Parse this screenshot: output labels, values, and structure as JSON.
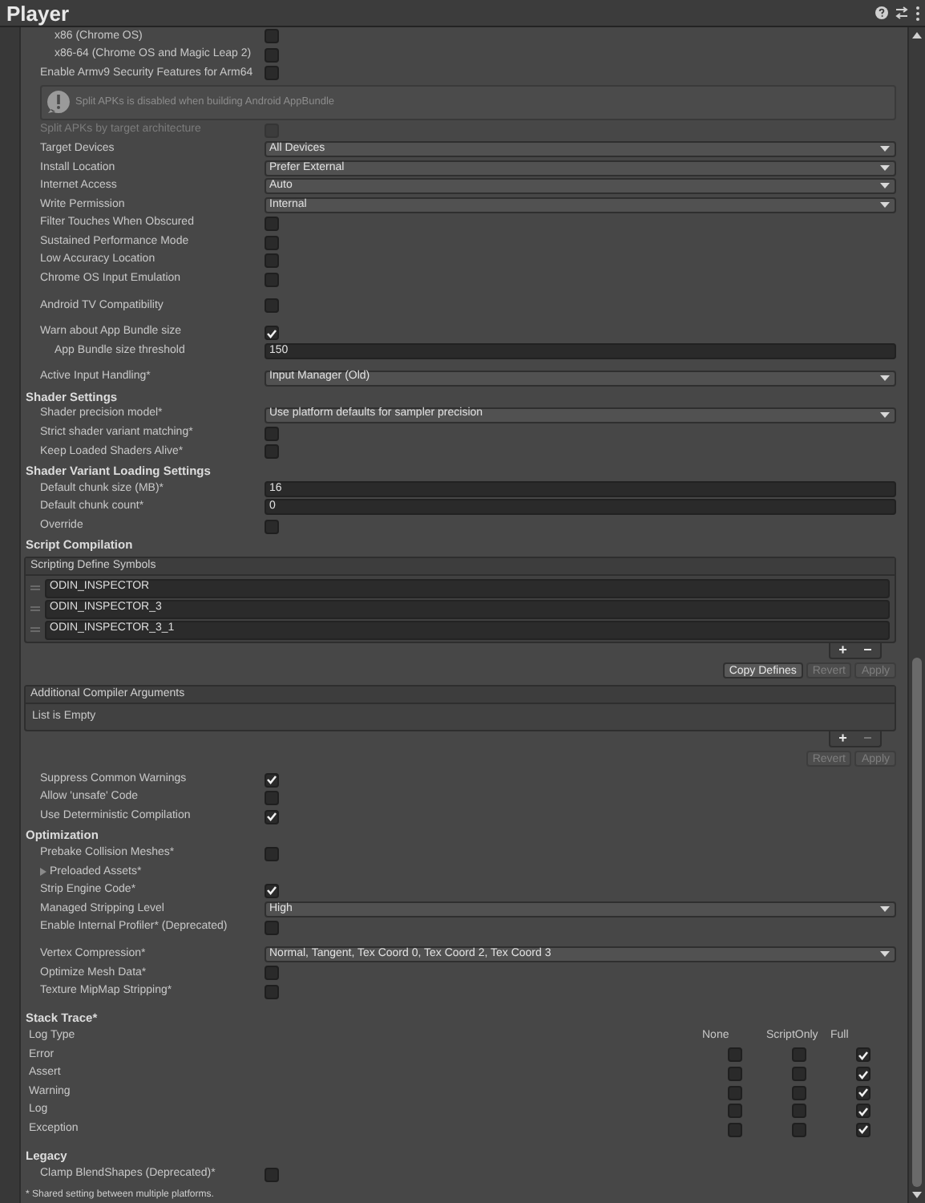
{
  "window": {
    "title": "Player"
  },
  "sections": [
    [
      {
        "kind": "toggle",
        "label": "x86 (Chrome OS)",
        "indented": true,
        "checked": false
      },
      {
        "kind": "toggle",
        "label": "x86-64 (Chrome OS and Magic Leap 2)",
        "indented": true,
        "checked": false
      },
      {
        "kind": "toggle",
        "label": "Enable Armv9 Security Features for Arm64",
        "checked": false
      },
      {
        "kind": "help",
        "text": "Split APKs is disabled when building Android AppBundle"
      },
      {
        "kind": "toggle",
        "label": "Split APKs by target architecture",
        "checked": false,
        "disabled": true
      },
      {
        "kind": "dropdown",
        "label": "Target Devices",
        "value": "All Devices"
      },
      {
        "kind": "dropdown",
        "label": "Install Location",
        "value": "Prefer External"
      },
      {
        "kind": "dropdown",
        "label": "Internet Access",
        "value": "Auto"
      },
      {
        "kind": "dropdown",
        "label": "Write Permission",
        "value": "Internal"
      },
      {
        "kind": "toggle",
        "label": "Filter Touches When Obscured",
        "checked": false
      },
      {
        "kind": "toggle",
        "label": "Sustained Performance Mode",
        "checked": false
      },
      {
        "kind": "toggle",
        "label": "Low Accuracy Location",
        "checked": false
      },
      {
        "kind": "toggle",
        "label": "Chrome OS Input Emulation",
        "checked": false
      }
    ],
    [
      {
        "kind": "toggle",
        "label": "Android TV Compatibility",
        "checked": false
      }
    ],
    [
      {
        "kind": "toggle",
        "label": "Warn about App Bundle size",
        "checked": true
      },
      {
        "kind": "number",
        "label": "App Bundle size threshold",
        "value": "150",
        "indented": true
      }
    ],
    [
      {
        "kind": "dropdown",
        "label": "Active Input Handling*",
        "value": "Input Manager (Old)"
      },
      {
        "kind": "header",
        "text": "Shader Settings"
      },
      {
        "kind": "dropdown",
        "label": "Shader precision model*",
        "value": "Use platform defaults for sampler precision"
      },
      {
        "kind": "toggle",
        "label": "Strict shader variant matching*",
        "checked": false
      },
      {
        "kind": "toggle",
        "label": "Keep Loaded Shaders Alive*",
        "checked": false
      },
      {
        "kind": "header",
        "text": "Shader Variant Loading Settings"
      },
      {
        "kind": "number",
        "label": "Default chunk size (MB)*",
        "value": "16"
      },
      {
        "kind": "number",
        "label": "Default chunk count*",
        "value": "0"
      },
      {
        "kind": "toggle",
        "label": "Override",
        "checked": false
      },
      {
        "kind": "header",
        "text": "Script Compilation"
      },
      {
        "kind": "list",
        "title": "Scripting Define Symbols",
        "items": [
          "ODIN_INSPECTOR",
          "ODIN_INSPECTOR_3",
          "ODIN_INSPECTOR_3_1"
        ],
        "add": "+",
        "remove": "−",
        "remove_disabled": false
      },
      {
        "kind": "actions",
        "buttons": [
          {
            "label": "Copy Defines",
            "disabled": false
          },
          {
            "label": "Revert",
            "disabled": true
          },
          {
            "label": "Apply",
            "disabled": true
          }
        ]
      },
      {
        "kind": "list",
        "title": "Additional Compiler Arguments",
        "empty_text": "List is Empty",
        "add": "+",
        "remove": "−",
        "remove_disabled": true
      },
      {
        "kind": "actions",
        "buttons": [
          {
            "label": "Revert",
            "disabled": true
          },
          {
            "label": "Apply",
            "disabled": true
          }
        ]
      },
      {
        "kind": "toggle",
        "label": "Suppress Common Warnings",
        "checked": true
      },
      {
        "kind": "toggle",
        "label": "Allow 'unsafe' Code",
        "checked": false
      },
      {
        "kind": "toggle",
        "label": "Use Deterministic Compilation",
        "checked": true
      },
      {
        "kind": "header",
        "text": "Optimization"
      },
      {
        "kind": "toggle",
        "label": "Prebake Collision Meshes*",
        "checked": false
      },
      {
        "kind": "foldout",
        "label": "Preloaded Assets*",
        "expanded": false
      },
      {
        "kind": "toggle",
        "label": "Strip Engine Code*",
        "checked": true
      },
      {
        "kind": "dropdown",
        "label": "Managed Stripping Level",
        "value": "High"
      },
      {
        "kind": "toggle",
        "label": "Enable Internal Profiler* (Deprecated)",
        "checked": false
      }
    ],
    [
      {
        "kind": "dropdown",
        "label": "Vertex Compression*",
        "value": "Normal, Tangent, Tex Coord 0, Tex Coord 2, Tex Coord 3"
      },
      {
        "kind": "toggle",
        "label": "Optimize Mesh Data*",
        "checked": false
      },
      {
        "kind": "toggle",
        "label": "Texture MipMap Stripping*",
        "checked": false
      }
    ],
    [
      {
        "kind": "header",
        "text": "Stack Trace*"
      },
      {
        "kind": "stack_trace",
        "columns": [
          "Log Type",
          "None",
          "ScriptOnly",
          "Full"
        ],
        "rows": [
          {
            "label": "Error",
            "none": false,
            "script_only": false,
            "full": true
          },
          {
            "label": "Assert",
            "none": false,
            "script_only": false,
            "full": true
          },
          {
            "label": "Warning",
            "none": false,
            "script_only": false,
            "full": true
          },
          {
            "label": "Log",
            "none": false,
            "script_only": false,
            "full": true
          },
          {
            "label": "Exception",
            "none": false,
            "script_only": false,
            "full": true
          }
        ]
      }
    ],
    [
      {
        "kind": "header",
        "text": "Legacy"
      },
      {
        "kind": "toggle",
        "label": "Clamp BlendShapes (Deprecated)*",
        "checked": false
      },
      {
        "kind": "note",
        "text": "* Shared setting between multiple platforms."
      }
    ]
  ]
}
